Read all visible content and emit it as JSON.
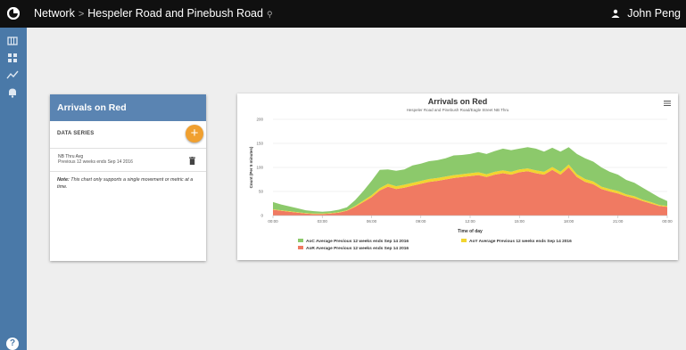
{
  "breadcrumb": {
    "network": "Network",
    "separator": ">",
    "location": "Hespeler Road and Pinebush Road"
  },
  "user": {
    "name": "John Peng"
  },
  "panel": {
    "title": "Arrivals on Red",
    "section_title": "DATA SERIES",
    "series_name": "NB Thru Avg",
    "series_desc": "Previous 12 weeks ends Sep 14 2016",
    "note_label": "Note:",
    "note_text": " This chart only supports a single movement or metric at a time."
  },
  "colors": {
    "aoc": "#8cc96b",
    "aoy": "#f2d52f",
    "aor": "#f07a62",
    "sidebar": "#4a79a8",
    "header": "#5a84b2",
    "fab": "#f0a030"
  },
  "chart_data": {
    "type": "area",
    "title": "Arrivals on Red",
    "subtitle": "Hespeler Road and Pinebush Road/Eagle Street NB Thru",
    "xlabel": "Time of day",
    "ylabel": "Count (Per 5 minutes)",
    "ylim": [
      0,
      200
    ],
    "yticks": [
      "0",
      "50",
      "100",
      "150",
      "200"
    ],
    "xlim": [
      0,
      24
    ],
    "xticks": [
      "00:00",
      "03:00",
      "06:00",
      "09:00",
      "12:00",
      "15:00",
      "18:00",
      "21:00",
      "00:00"
    ],
    "stacked": true,
    "x": [
      0,
      0.5,
      1,
      1.5,
      2,
      2.5,
      3,
      3.5,
      4,
      4.5,
      5,
      5.5,
      6,
      6.5,
      7,
      7.5,
      8,
      8.5,
      9,
      9.5,
      10,
      10.5,
      11,
      11.5,
      12,
      12.5,
      13,
      13.5,
      14,
      14.5,
      15,
      15.5,
      16,
      16.5,
      17,
      17.5,
      18,
      18.5,
      19,
      19.5,
      20,
      20.5,
      21,
      21.5,
      22,
      22.5,
      23,
      23.5,
      24
    ],
    "series": [
      {
        "name": "AoR Average Previous 12 weeks ends Sep 14 2016",
        "color": "#f07a62",
        "values": [
          12,
          10,
          8,
          6,
          4,
          3,
          3,
          4,
          6,
          10,
          18,
          28,
          38,
          52,
          60,
          55,
          58,
          62,
          66,
          70,
          72,
          75,
          78,
          80,
          82,
          84,
          80,
          85,
          88,
          85,
          90,
          92,
          88,
          85,
          95,
          85,
          100,
          80,
          70,
          65,
          55,
          50,
          46,
          40,
          36,
          30,
          25,
          20,
          18
        ]
      },
      {
        "name": "AoY Average Previous 12 weeks ends Sep 14 2016",
        "color": "#f2d52f",
        "values": [
          1,
          1,
          1,
          1,
          1,
          1,
          1,
          1,
          1,
          1,
          2,
          3,
          4,
          5,
          6,
          6,
          6,
          6,
          6,
          6,
          6,
          6,
          6,
          6,
          6,
          6,
          6,
          6,
          6,
          6,
          6,
          6,
          6,
          6,
          6,
          6,
          6,
          6,
          6,
          6,
          5,
          5,
          5,
          4,
          4,
          3,
          3,
          2,
          2
        ]
      },
      {
        "name": "AoC Average Previous 12 weeks ends Sep 14 2016",
        "color": "#8cc96b",
        "values": [
          15,
          12,
          10,
          8,
          6,
          5,
          4,
          4,
          5,
          6,
          12,
          20,
          30,
          38,
          30,
          32,
          32,
          36,
          36,
          37,
          37,
          38,
          41,
          40,
          40,
          42,
          42,
          43,
          45,
          45,
          43,
          44,
          45,
          42,
          40,
          42,
          36,
          42,
          43,
          41,
          40,
          36,
          34,
          30,
          28,
          25,
          20,
          16,
          10
        ]
      }
    ],
    "legend": {
      "position": "bottom",
      "items": [
        {
          "label": "AoC Average Previous 12 weeks ends Sep 14 2016",
          "color": "#8cc96b"
        },
        {
          "label": "AoY Average Previous 12 weeks ends Sep 14 2016",
          "color": "#f2d52f"
        },
        {
          "label": "AoR Average Previous 12 weeks ends Sep 14 2016",
          "color": "#f07a62"
        }
      ]
    },
    "grid": true
  }
}
